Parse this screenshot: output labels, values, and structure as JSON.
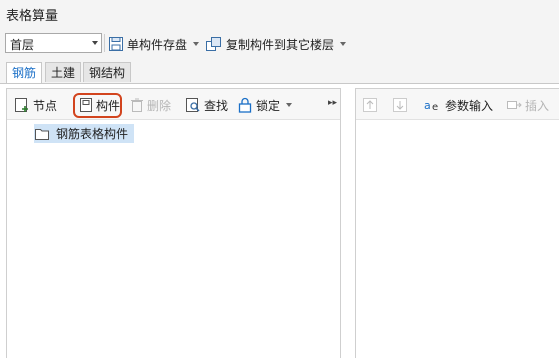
{
  "window": {
    "title": "表格算量"
  },
  "toolbar": {
    "floor_value": "首层",
    "save_label": "单构件存盘",
    "copy_label": "复制构件到其它楼层"
  },
  "tabs": [
    {
      "label": "钢筋",
      "active": true
    },
    {
      "label": "土建",
      "active": false
    },
    {
      "label": "钢结构",
      "active": false
    }
  ],
  "left_toolbar": {
    "node_label": "节点",
    "component_label": "构件",
    "delete_label": "删除",
    "find_label": "查找",
    "lock_label": "锁定"
  },
  "tree": {
    "root_label": "钢筋表格构件"
  },
  "right_toolbar": {
    "param_input_label": "参数输入",
    "insert_label": "插入"
  },
  "colors": {
    "accent": "#1a6fc7",
    "highlight": "#d2441e",
    "selection": "#cfe3f6"
  }
}
